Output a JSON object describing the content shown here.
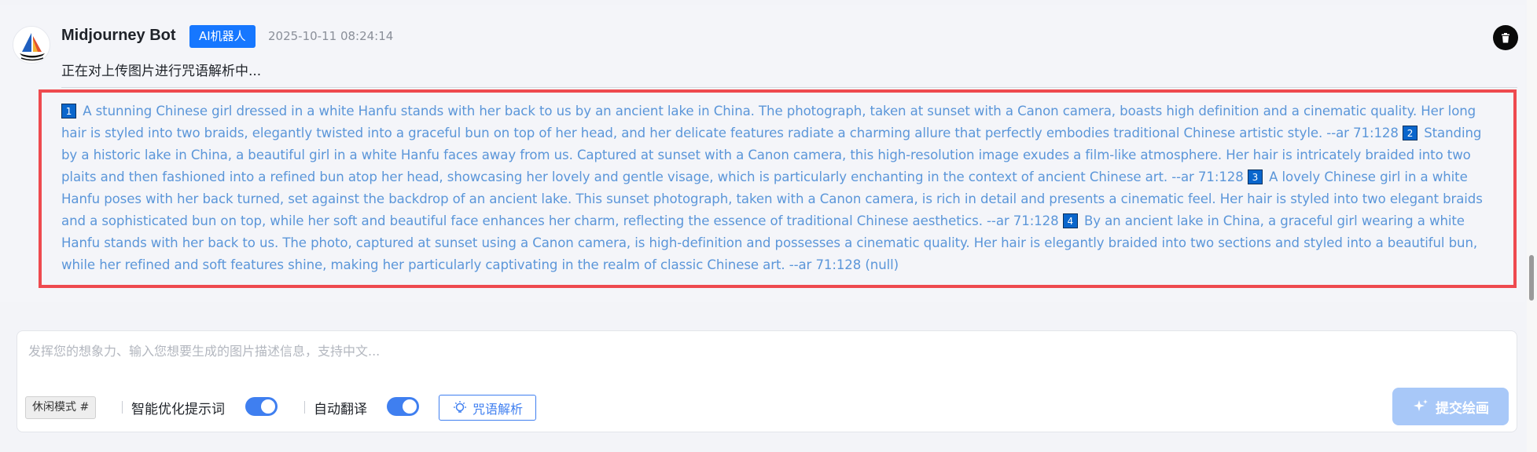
{
  "message": {
    "bot_name": "Midjourney Bot",
    "badge": "AI机器人",
    "timestamp": "2025-10-11 08:24:14",
    "status": "正在对上传图片进行咒语解析中...",
    "results": [
      {
        "num": "1",
        "text": "A stunning Chinese girl dressed in a white Hanfu stands with her back to us by an ancient lake in China. The photograph, taken at sunset with a Canon camera, boasts high definition and a cinematic quality. Her long hair is styled into two braids, elegantly twisted into a graceful bun on top of her head, and her delicate features radiate a charming allure that perfectly embodies traditional Chinese artistic style. --ar 71:128"
      },
      {
        "num": "2",
        "text": "Standing by a historic lake in China, a beautiful girl in a white Hanfu faces away from us. Captured at sunset with a Canon camera, this high-resolution image exudes a film-like atmosphere. Her hair is intricately braided into two plaits and then fashioned into a refined bun atop her head, showcasing her lovely and gentle visage, which is particularly enchanting in the context of ancient Chinese art. --ar 71:128"
      },
      {
        "num": "3",
        "text": "A lovely Chinese girl in a white Hanfu poses with her back turned, set against the backdrop of an ancient lake. This sunset photograph, taken with a Canon camera, is rich in detail and presents a cinematic feel. Her hair is styled into two elegant braids and a sophisticated bun on top, while her soft and beautiful face enhances her charm, reflecting the essence of traditional Chinese aesthetics. --ar 71:128"
      },
      {
        "num": "4",
        "text": "By an ancient lake in China, a graceful girl wearing a white Hanfu stands with her back to us. The photo, captured at sunset using a Canon camera, is high-definition and possesses a cinematic quality. Her hair is elegantly braided into two sections and styled into a beautiful bun, while her refined and soft features shine, making her particularly captivating in the realm of classic Chinese art. --ar 71:128"
      }
    ],
    "trailing": "(null)"
  },
  "composer": {
    "placeholder": "发挥您的想象力、输入您想要生成的图片描述信息，支持中文...",
    "mode_tag": "休闲模式 #",
    "smart_prompt_label": "智能优化提示词",
    "smart_prompt_on": true,
    "auto_translate_label": "自动翻译",
    "auto_translate_on": true,
    "spell_parse_label": "咒语解析",
    "submit_label": "提交绘画"
  },
  "colors": {
    "accent": "#1677ff",
    "toggle": "#3f7ff0",
    "highlight_border": "#ee4a4f",
    "result_text": "#5b96d9",
    "submit_disabled": "#a8c8f8"
  },
  "icons": [
    "sailboat-logo-icon",
    "trash-icon",
    "lightbulb-icon",
    "sparkle-icon"
  ]
}
